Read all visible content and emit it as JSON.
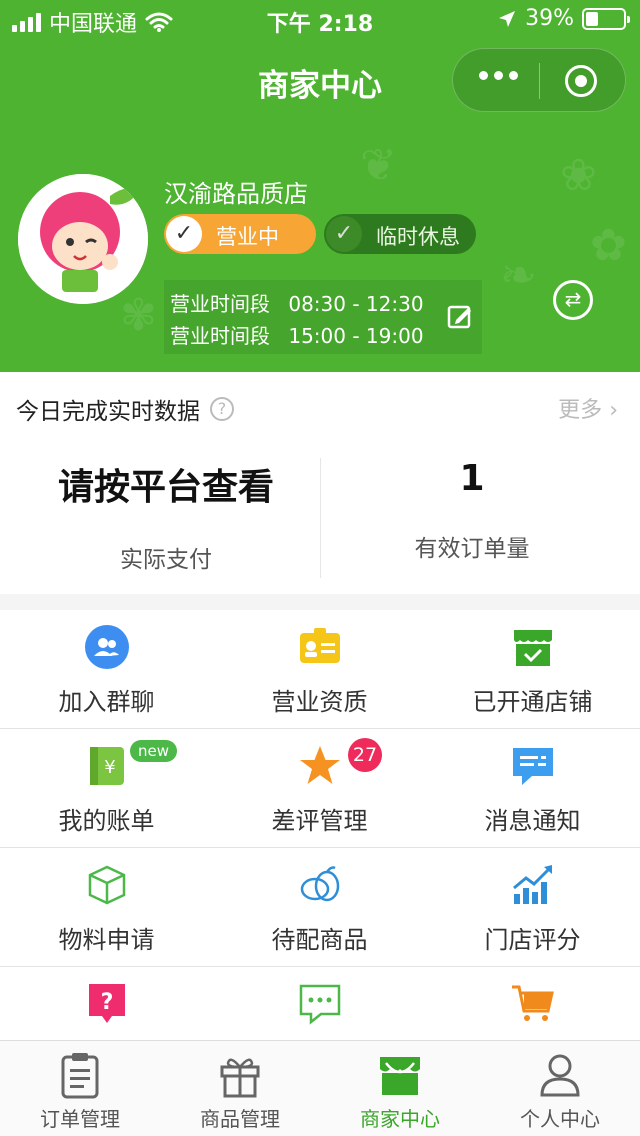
{
  "status_bar": {
    "carrier": "中国联通",
    "time": "下午 2:18",
    "battery": "39%",
    "battery_level": 0.39
  },
  "nav": {
    "title": "商家中心"
  },
  "store": {
    "name": "汉渝路品质店",
    "status_open_label": "营业中",
    "status_rest_label": "临时休息",
    "hours": [
      {
        "label": "营业时间段",
        "range": "08:30 - 12:30"
      },
      {
        "label": "营业时间段",
        "range": "15:00 - 19:00"
      }
    ]
  },
  "realtime": {
    "title": "今日完成实时数据",
    "more": "更多",
    "stats": [
      {
        "value": "请按平台查看",
        "label": "实际支付"
      },
      {
        "value": "1",
        "label": "有效订单量"
      }
    ]
  },
  "grid": {
    "items": [
      {
        "label": "加入群聊",
        "icon": "group-chat-icon"
      },
      {
        "label": "营业资质",
        "icon": "license-icon"
      },
      {
        "label": "已开通店铺",
        "icon": "store-icon"
      },
      {
        "label": "我的账单",
        "icon": "bill-icon",
        "badge": "new"
      },
      {
        "label": "差评管理",
        "icon": "star-icon",
        "badge": "27"
      },
      {
        "label": "消息通知",
        "icon": "message-icon"
      },
      {
        "label": "物料申请",
        "icon": "box-icon"
      },
      {
        "label": "待配商品",
        "icon": "produce-icon"
      },
      {
        "label": "门店评分",
        "icon": "chart-icon"
      },
      {
        "label": "",
        "icon": "help-icon"
      },
      {
        "label": "",
        "icon": "chat-icon"
      },
      {
        "label": "",
        "icon": "cart-icon"
      }
    ]
  },
  "tabbar": {
    "tabs": [
      {
        "label": "订单管理",
        "icon": "clipboard-icon"
      },
      {
        "label": "商品管理",
        "icon": "gift-icon"
      },
      {
        "label": "商家中心",
        "icon": "shop-icon",
        "active": true
      },
      {
        "label": "个人中心",
        "icon": "person-icon"
      }
    ]
  },
  "colors": {
    "brand_green": "#4db330",
    "open_orange": "#f7a535",
    "badge_red": "#ee2b5b"
  }
}
